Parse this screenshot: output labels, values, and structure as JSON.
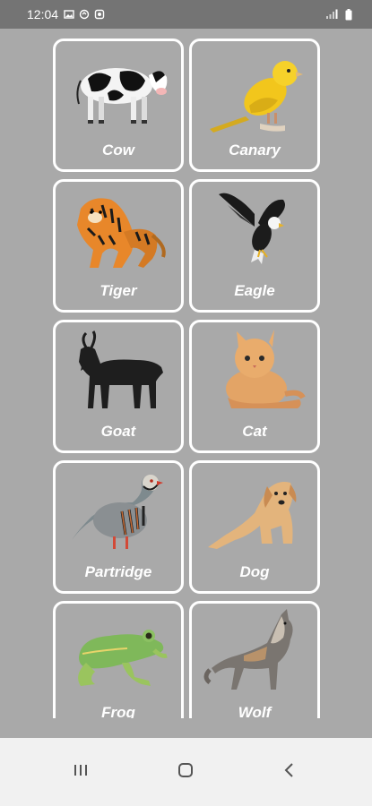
{
  "status_bar": {
    "time": "12:04",
    "left_icons": [
      "image-icon",
      "sync-icon",
      "app-icon"
    ],
    "right_icons": [
      "signal-icon",
      "battery-icon"
    ]
  },
  "animals": [
    {
      "label": "Cow",
      "icon": "cow-image"
    },
    {
      "label": "Canary",
      "icon": "canary-image"
    },
    {
      "label": "Tiger",
      "icon": "tiger-image"
    },
    {
      "label": "Eagle",
      "icon": "eagle-image"
    },
    {
      "label": "Goat",
      "icon": "goat-image"
    },
    {
      "label": "Cat",
      "icon": "cat-image"
    },
    {
      "label": "Partridge",
      "icon": "partridge-image"
    },
    {
      "label": "Dog",
      "icon": "dog-image"
    },
    {
      "label": "Frog",
      "icon": "frog-image"
    },
    {
      "label": "Wolf",
      "icon": "wolf-image"
    }
  ],
  "nav_bar": {
    "buttons": [
      "recent-apps-icon",
      "home-icon",
      "back-icon"
    ]
  },
  "colors": {
    "background": "#a9a9a9",
    "status_bar": "#747474",
    "card_border": "#ffffff",
    "nav_bar": "#f1f1f1"
  }
}
